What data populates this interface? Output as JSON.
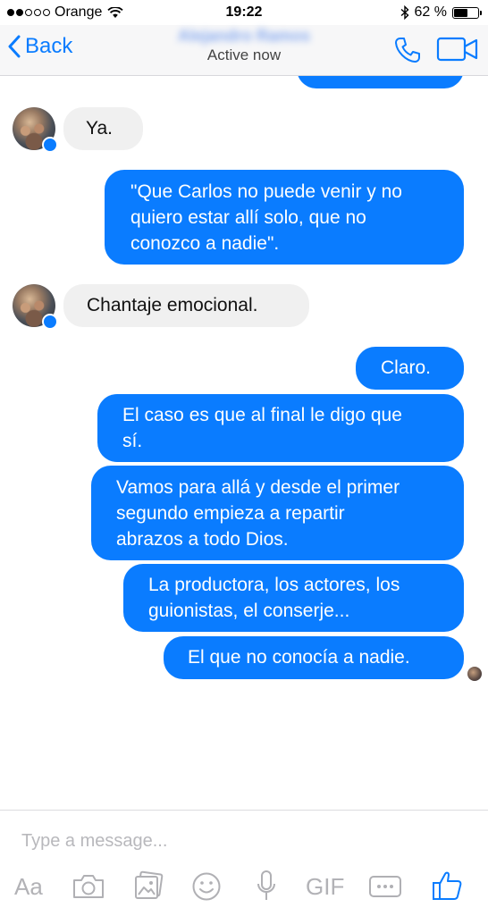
{
  "status_bar": {
    "carrier": "Orange",
    "time": "19:22",
    "battery_percent": "62 %",
    "battery_level": 0.62,
    "signal_bars_filled": 2,
    "signal_bars_total": 5
  },
  "nav": {
    "back_label": "Back",
    "contact_name": "Alejandro Ramos",
    "status": "Active now",
    "accent_color": "#0a7cff"
  },
  "messages": [
    {
      "direction": "in",
      "text": "Ya."
    },
    {
      "direction": "out",
      "lines": [
        "\"Que Carlos no puede venir y no",
        "quiero estar allí solo, que no",
        "conozco a nadie\"."
      ]
    },
    {
      "direction": "in",
      "text": "Chantaje emocional."
    },
    {
      "direction": "out",
      "text": "Claro."
    },
    {
      "direction": "out",
      "lines": [
        "El caso es que al final le digo que",
        "sí."
      ]
    },
    {
      "direction": "out",
      "lines": [
        "Vamos para allá y desde el primer",
        "segundo empieza a repartir",
        "abrazos a todo Dios."
      ]
    },
    {
      "direction": "out",
      "lines": [
        "La productora, los actores, los",
        "guionistas, el conserje..."
      ]
    },
    {
      "direction": "out",
      "text": "El que no conocía a nadie."
    }
  ],
  "composer": {
    "placeholder": "Type a message...",
    "aa_label": "Aa",
    "gif_label": "GIF",
    "icons": [
      "text-format-icon",
      "camera-icon",
      "photo-gallery-icon",
      "emoji-icon",
      "microphone-icon",
      "gif-icon",
      "more-icon",
      "like-icon"
    ]
  }
}
